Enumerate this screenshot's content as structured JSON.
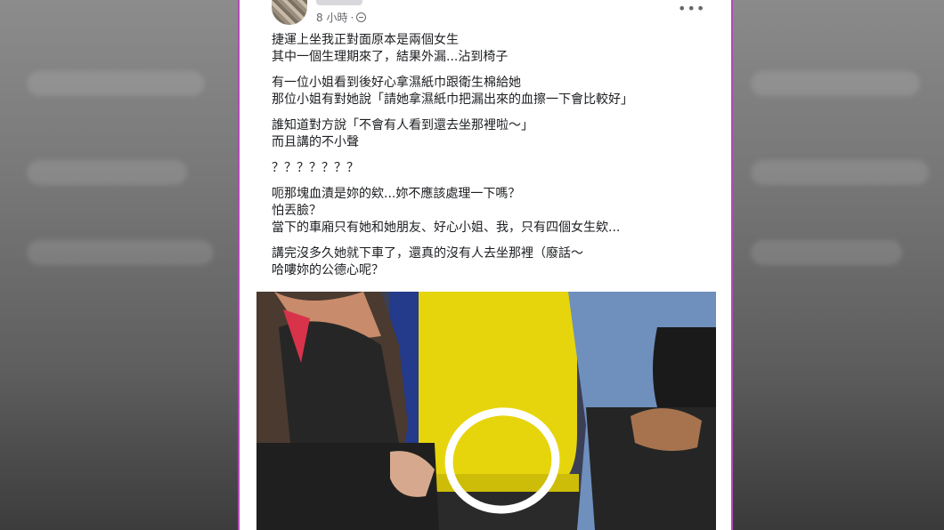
{
  "post": {
    "time": "8 小時",
    "separator": "·",
    "more_icon": "more-dots-icon",
    "privacy_icon": "globe-icon",
    "paragraphs": [
      [
        "捷運上坐我正對面原本是兩個女生",
        "其中一個生理期來了，結果外漏...沾到椅子"
      ],
      [
        "有一位小姐看到後好心拿濕紙巾跟衛生棉給她",
        "那位小姐有對她說「請她拿濕紙巾把漏出來的血擦一下會比較好」"
      ],
      [
        "誰知道對方說「不會有人看到還去坐那裡啦～」",
        "而且講的不小聲"
      ],
      [
        "？？？？？？？"
      ],
      [
        "呃那塊血漬是妳的欸...妳不應該處理一下嗎？",
        "怕丟臉？",
        "當下的車廂只有她和她朋友、好心小姐、我，只有四個女生欸..."
      ],
      [
        "講完沒多久她就下車了，還真的沒有人去坐那裡（廢話～",
        "哈嘍妳的公德心呢？"
      ]
    ]
  },
  "colors": {
    "frame_accent": "#b14bb6",
    "seat_yellow": "#e6d50c",
    "circle": "#ffffff"
  }
}
